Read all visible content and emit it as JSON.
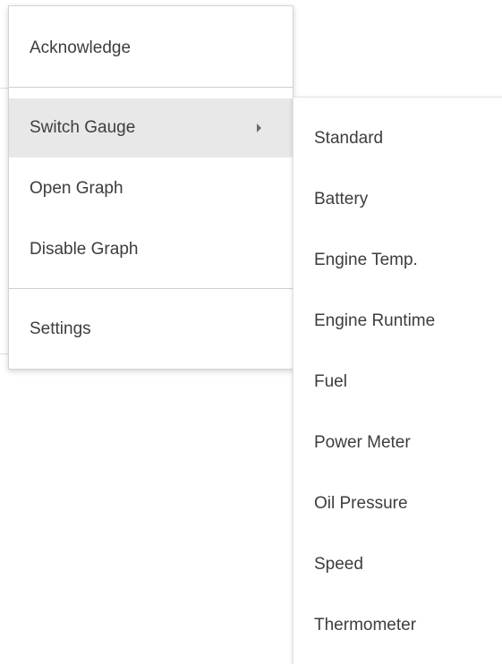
{
  "menu": {
    "items": [
      {
        "label": "Acknowledge"
      },
      {
        "label": "Switch Gauge",
        "has_submenu": true,
        "active": true
      },
      {
        "label": "Open Graph"
      },
      {
        "label": "Disable Graph"
      },
      {
        "label": "Settings"
      }
    ],
    "submenu_indicator_icon": "caret-right-icon"
  },
  "submenu": {
    "items": [
      {
        "label": "Standard"
      },
      {
        "label": "Battery"
      },
      {
        "label": "Engine Temp."
      },
      {
        "label": "Engine Runtime"
      },
      {
        "label": "Fuel"
      },
      {
        "label": "Power Meter"
      },
      {
        "label": "Oil Pressure"
      },
      {
        "label": "Speed"
      },
      {
        "label": "Thermometer"
      }
    ]
  },
  "colors": {
    "text": "#3d3d3d",
    "active_background": "#e8e8e8",
    "divider": "#cfcfcf",
    "menu_background": "#ffffff"
  }
}
